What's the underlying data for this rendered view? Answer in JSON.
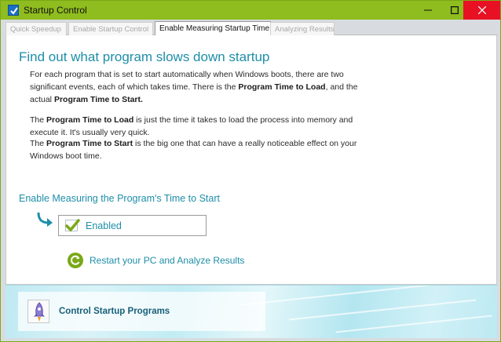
{
  "window": {
    "title": "Startup Control",
    "controls": {
      "minimize": "▬",
      "maximize": "■",
      "close": "✕"
    }
  },
  "tabs": [
    {
      "label": "Quick Speedup",
      "active": false
    },
    {
      "label": "Enable Startup Control",
      "active": false
    },
    {
      "label": "Enable Measuring Startup Time",
      "active": true
    },
    {
      "label": "Analyzing Results",
      "active": false
    }
  ],
  "main": {
    "heading": "Find out what program slows down startup",
    "para1": {
      "a": "For each program that is set to start automatically when Windows boots, there are two significant events, each of which takes time.  There is the ",
      "b": "Program Time to Load",
      "c": ", and the actual ",
      "d": "Program Time to Start."
    },
    "para2": {
      "a": "The ",
      "b": "Program Time to Load",
      "c": " is just the time it takes to load the process into memory and execute it. It's usually very quick."
    },
    "para3": {
      "a": "The ",
      "b": "Program Time to Start",
      "c": " is the big one that can have a really noticeable effect on your Windows boot time."
    },
    "section_label": "Enable Measuring the Program's Time to Start",
    "enabled_checkbox": {
      "label": "Enabled",
      "checked": true
    },
    "restart_link": "Restart your PC and Analyze Results"
  },
  "footer": {
    "control_button_label": "Control Startup Programs"
  },
  "colors": {
    "accent": "#1e8ea8",
    "titlebar": "#8fbc1e",
    "close_button": "#e81123",
    "check_green": "#7aa817"
  },
  "icons": {
    "app": "checkbox-app-icon",
    "arrow": "curved-arrow-icon",
    "check": "checkmark-icon",
    "restart": "refresh-icon",
    "control": "rocket-icon"
  }
}
